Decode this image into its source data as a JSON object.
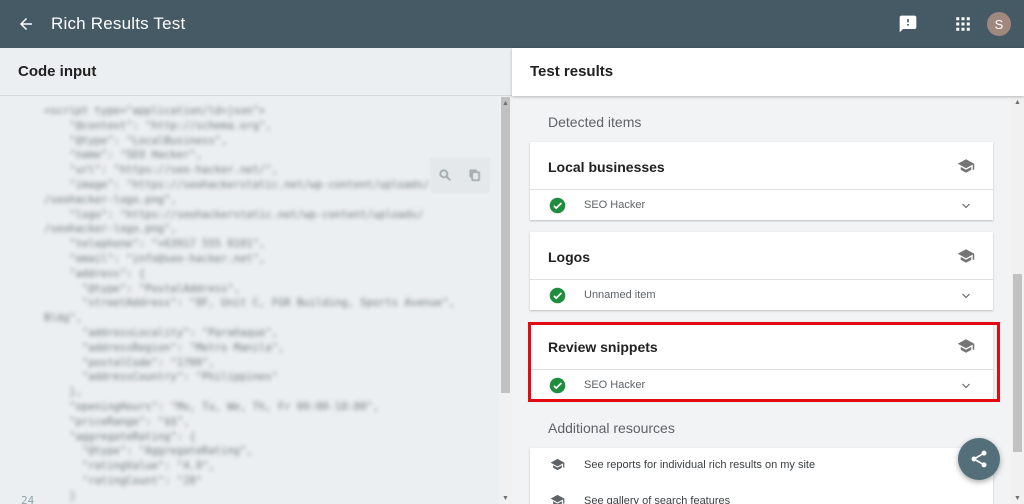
{
  "appbar": {
    "title": "Rich Results Test",
    "avatar_initial": "S",
    "icons": [
      "arrow-back-icon",
      "feedback-icon",
      "apps-grid-icon"
    ]
  },
  "left": {
    "title": "Code input",
    "last_line_number": "24",
    "code_lines": [
      "<script type=\"application/ld+json\">",
      "    \"@context\": \"http://schema.org\",",
      "    \"@type\": \"LocalBusiness\",",
      "    \"name\": \"SEO Hacker\",",
      "    \"url\": \"https://seo-hacker.net/\",",
      "    \"image\": \"https://seohackerstatic.net/wp-content/uploads/",
      "/seohacker-logo.png\",",
      "    \"logo\": \"https://seohackerstatic.net/wp-content/uploads/",
      "/seohacker-logo.png\",",
      "    \"telephone\": \"+63917 555 0101\",",
      "    \"email\": \"info@seo-hacker.net\",",
      "    \"address\": {",
      "      \"@type\": \"PostalAddress\",",
      "      \"streetAddress\": \"8F, Unit C, FGR Building, Sports Avenue\",",
      "Bldg\",",
      "      \"addressLocality\": \"Parañaque\",",
      "      \"addressRegion\": \"Metro Manila\",",
      "      \"postalCode\": \"1700\",",
      "      \"addressCountry\": \"Philippines\"",
      "    },",
      "    \"openingHours\": \"Mo, Tu, We, Th, Fr 09:00-18:00\",",
      "    \"priceRange\": \"$$\",",
      "    \"aggregateRating\": {",
      "      \"@type\": \"AggregateRating\",",
      "      \"ratingValue\": \"4.9\",",
      "      \"ratingCount\": \"28\"",
      "    }"
    ]
  },
  "right": {
    "title": "Test results",
    "detected_label": "Detected items",
    "cards": [
      {
        "title": "Local businesses",
        "row": "SEO Hacker"
      },
      {
        "title": "Logos",
        "row": "Unnamed item"
      },
      {
        "title": "Review snippets",
        "row": "SEO Hacker"
      }
    ],
    "resources_label": "Additional resources",
    "resources": [
      "See reports for individual rich results on my site",
      "See gallery of search features"
    ]
  },
  "colors": {
    "appbar": "#455a64",
    "check_green": "#1e8e3e",
    "highlight_red": "#e50914",
    "fab": "#546e7a"
  }
}
